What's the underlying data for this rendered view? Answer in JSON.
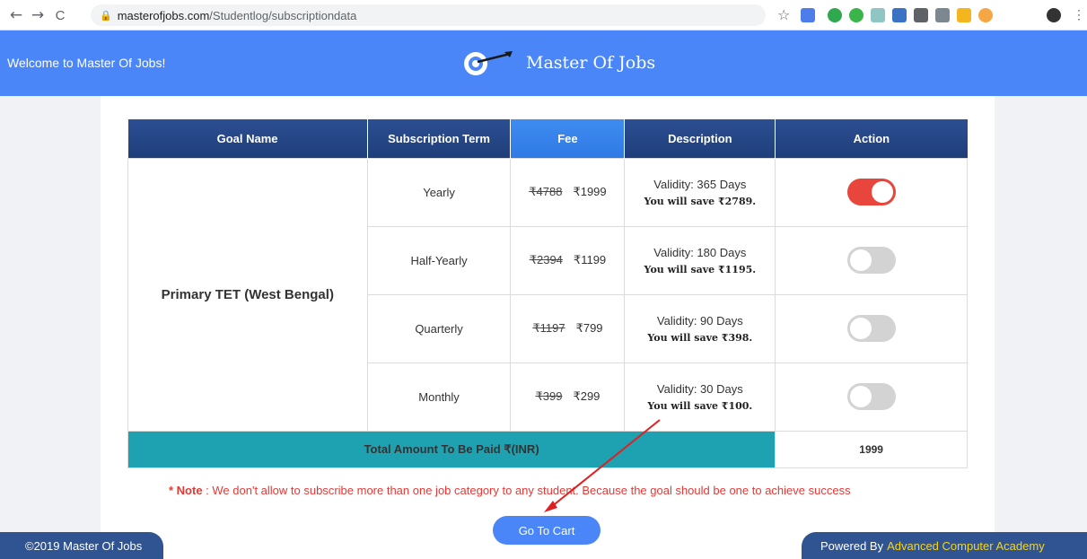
{
  "browser": {
    "back_icon": "←",
    "forward_icon": "→",
    "reload_icon": "C",
    "url_domain": "masterofjobs.com",
    "url_path": "/Studentlog/subscriptiondata"
  },
  "header": {
    "welcome": "Welcome to Master Of Jobs!",
    "brand": "Master Of Jobs",
    "color": "#4a86f7"
  },
  "table": {
    "headers": [
      "Goal Name",
      "Subscription Term",
      "Fee",
      "Description",
      "Action"
    ],
    "goal": "Primary TET (West Bengal)",
    "rows": [
      {
        "term": "Yearly",
        "old_fee": "₹4788",
        "fee": "₹1999",
        "validity": "Validity: 365 Days",
        "save": "You will save ₹2789.",
        "selected": true
      },
      {
        "term": "Half-Yearly",
        "old_fee": "₹2394",
        "fee": "₹1199",
        "validity": "Validity: 180 Days",
        "save": "You will save ₹1195.",
        "selected": false
      },
      {
        "term": "Quarterly",
        "old_fee": "₹1197",
        "fee": "₹799",
        "validity": "Validity: 90 Days",
        "save": "You will save ₹398.",
        "selected": false
      },
      {
        "term": "Monthly",
        "old_fee": "₹399",
        "fee": "₹299",
        "validity": "Validity: 30 Days",
        "save": "You will save ₹100.",
        "selected": false
      }
    ],
    "total_label": "Total Amount To Be Paid ₹(INR)",
    "total_value": "1999"
  },
  "note": {
    "prefix": "* Note",
    "text": " : We don't allow to subscribe more than one job category to any student. Because the goal should be one to achieve success"
  },
  "cart_button": "Go To Cart",
  "footer": {
    "copyright": "©2019 Master Of Jobs",
    "powered_by": "Powered By",
    "academy": "Advanced Computer Academy"
  }
}
